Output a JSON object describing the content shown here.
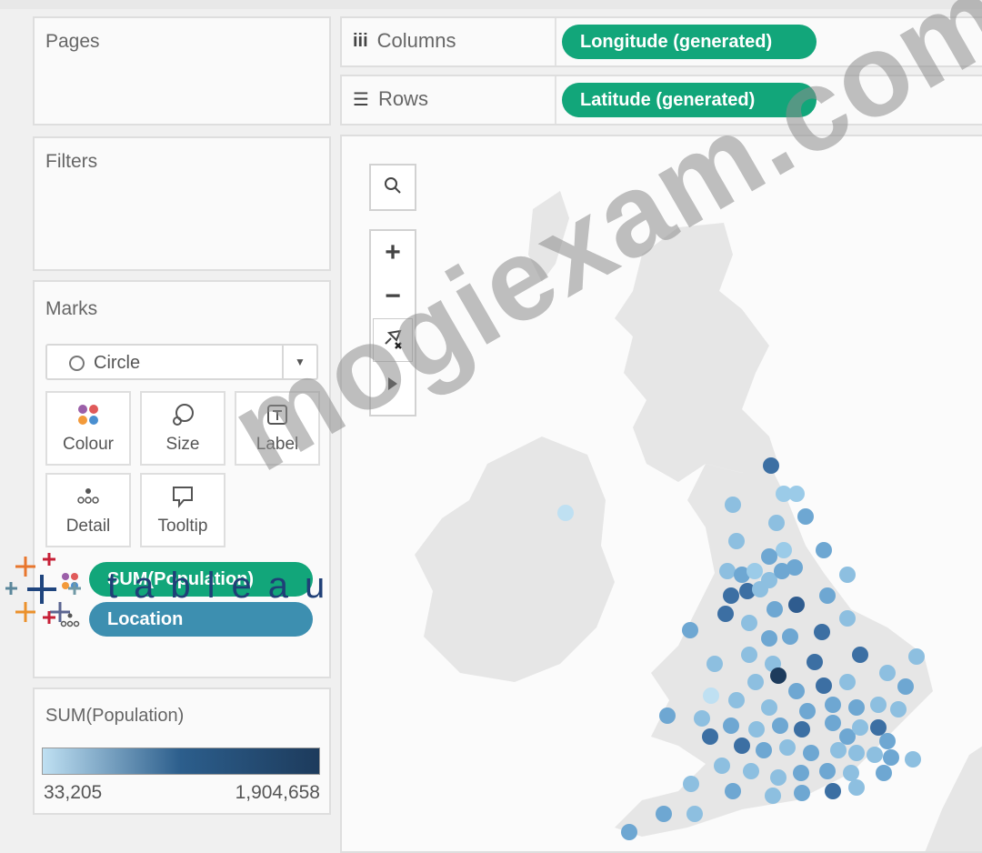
{
  "pages": {
    "title": "Pages"
  },
  "filters": {
    "title": "Filters"
  },
  "marks": {
    "title": "Marks",
    "mark_type": "Circle",
    "buttons": {
      "colour": "Colour",
      "size": "Size",
      "label": "Label",
      "detail": "Detail",
      "tooltip": "Tooltip"
    },
    "fields": [
      {
        "label": "SUM(Population)",
        "icon": "colour-dots-icon"
      },
      {
        "label": "Location",
        "icon": "detail-dots-icon"
      }
    ]
  },
  "shelves": {
    "columns": {
      "label": "Columns",
      "pill": "Longitude (generated)",
      "icon": "columns-icon"
    },
    "rows": {
      "label": "Rows",
      "pill": "Latitude (generated)",
      "icon": "rows-icon"
    }
  },
  "legend": {
    "title": "SUM(Population)",
    "min": "33,205",
    "max": "1,904,658"
  },
  "map_tools": {
    "search": "search-icon",
    "zoom_in": "+",
    "zoom_out": "−",
    "pin": "unpin-icon",
    "expand": "play-icon"
  },
  "overlays": {
    "watermark": "mogiexam.com",
    "logo_text": "tableau"
  },
  "colors": {
    "pill_green": "#12a67a",
    "pill_blue": "#3d8fb0",
    "low": "#bfe0f2",
    "high": "#1d3b5c",
    "land": "#e6e6e6"
  }
}
